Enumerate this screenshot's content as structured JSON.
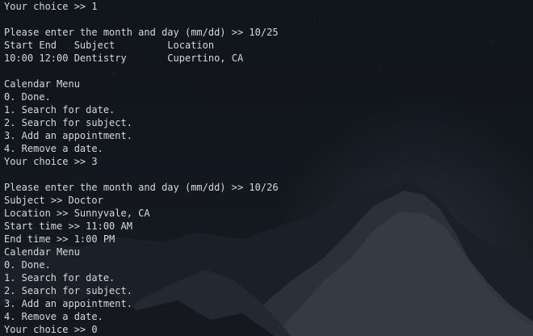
{
  "terminal": {
    "lines": [
      "Your choice >> 1",
      "",
      "Please enter the month and day (mm/dd) >> 10/25",
      "Start End   Subject         Location",
      "10:00 12:00 Dentistry       Cupertino, CA",
      "",
      "Calendar Menu",
      "0. Done.",
      "1. Search for date.",
      "2. Search for subject.",
      "3. Add an appointment.",
      "4. Remove a date.",
      "Your choice >> 3",
      "",
      "Please enter the month and day (mm/dd) >> 10/26",
      "Subject >> Doctor",
      "Location >> Sunnyvale, CA",
      "Start time >> 11:00 AM",
      "End time >> 1:00 PM",
      "Calendar Menu",
      "0. Done.",
      "1. Search for date.",
      "2. Search for subject.",
      "3. Add an appointment.",
      "4. Remove a date.",
      "Your choice >> 0"
    ]
  }
}
